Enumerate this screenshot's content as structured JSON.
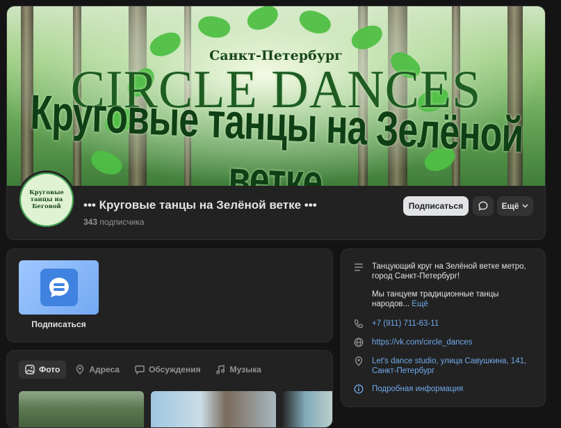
{
  "cover": {
    "city": "Санкт-Петербург",
    "brand": "CIRCLE DANCES",
    "ribbon": "Круговые танцы на Зелёной ветке"
  },
  "avatar": {
    "text": "Круговые танцы на Беговой"
  },
  "header": {
    "name": "••• Круговые танцы на Зелёной ветке •••",
    "members_count": "343",
    "members_label": "подписчика",
    "subscribe_label": "Подписаться",
    "more_label": "Ещё"
  },
  "widget": {
    "label": "Подписаться"
  },
  "tabs": [
    {
      "label": "Фото",
      "icon": "image-icon",
      "active": true
    },
    {
      "label": "Адреса",
      "icon": "location-pin-icon",
      "active": false
    },
    {
      "label": "Обсуждения",
      "icon": "chat-bubble-icon",
      "active": false
    },
    {
      "label": "Музыка",
      "icon": "music-note-icon",
      "active": false
    }
  ],
  "info": {
    "description_1": "Танцующий круг на Зелёной ветке метро, город Санкт-Петербург!",
    "description_2": "Мы танцуем традиционные танцы народов...",
    "more_link": "Ещё",
    "phone": "+7 (911) 711-63-11",
    "website": "https://vk.com/circle_dances",
    "address": "Let's dance studio, улица Савушкина, 141, Санкт-Петербург",
    "details_link": "Подробная информация"
  },
  "colors": {
    "background": "#141414",
    "card": "#222222",
    "link": "#71aaeb",
    "primary_button": "#e1e3e6"
  }
}
